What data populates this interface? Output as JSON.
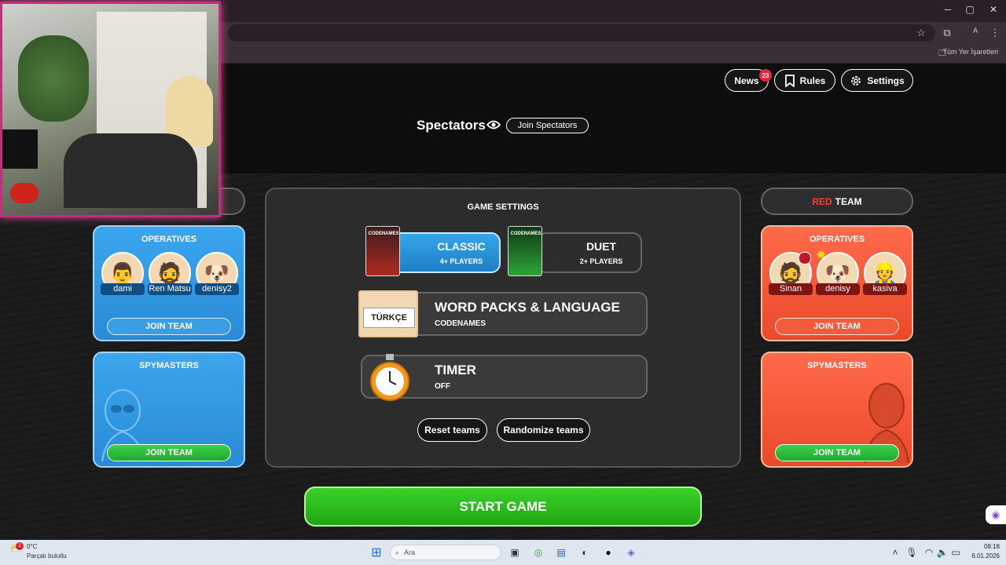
{
  "browser": {
    "bookmarks_label": "Tüm Yer İşaretleri",
    "profile_initial": "A"
  },
  "header": {
    "news_label": "News",
    "news_badge": "23",
    "rules_label": "Rules",
    "settings_label": "Settings"
  },
  "spectators": {
    "title": "Spectators",
    "join_label": "Join Spectators"
  },
  "red_team": {
    "title_red": "RED",
    "title_rest": "TEAM",
    "operatives_title": "OPERATIVES",
    "operatives": [
      "Sinan",
      "denisy",
      "kasiva"
    ],
    "join_operatives_label": "JOIN TEAM",
    "spymasters_title": "SPYMASTERS",
    "join_spymasters_label": "JOIN TEAM"
  },
  "blue_team": {
    "operatives_title": "OPERATIVES",
    "operatives": [
      "dami",
      "Ren Matsu",
      "denisy2"
    ],
    "join_operatives_label": "JOIN TEAM",
    "spymasters_title": "SPYMASTERS",
    "join_spymasters_label": "JOIN TEAM"
  },
  "game_settings": {
    "title": "GAME SETTINGS",
    "modes": [
      {
        "name": "CLASSIC",
        "players": "4+ PLAYERS",
        "selected": true,
        "box_text": "CODENAMES"
      },
      {
        "name": "DUET",
        "players": "2+ PLAYERS",
        "selected": false,
        "box_text": "CODENAMES"
      }
    ],
    "word_packs": {
      "title": "WORD PACKS & LANGUAGE",
      "value": "CODENAMES",
      "flag_text": "TÜRKÇE"
    },
    "timer": {
      "title": "TIMER",
      "value": "OFF"
    },
    "reset_label": "Reset teams",
    "randomize_label": "Randomize teams"
  },
  "start_label": "START GAME",
  "taskbar": {
    "weather_temp": "0°C",
    "weather_desc": "Parçalı bulutlu",
    "search_placeholder": "Ara",
    "time": "08:18",
    "date": "6.01.2026",
    "notif_badge": "1"
  },
  "colors": {
    "blue_team": "#2a8ad6",
    "red_team": "#ef5a3a",
    "start_green": "#2bbf1f",
    "red_accent": "#ff3b2f"
  }
}
